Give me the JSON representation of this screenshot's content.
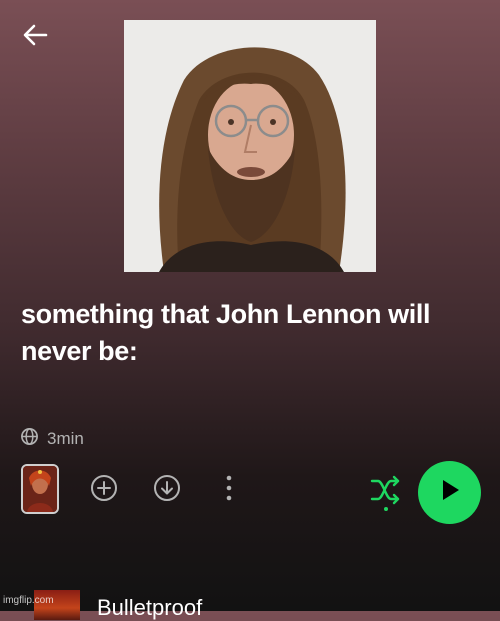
{
  "header": {
    "back_icon": "arrow-left-icon"
  },
  "playlist": {
    "title": "something that John Lennon will never be:",
    "duration": "3min",
    "globe_icon": "globe-icon"
  },
  "controls": {
    "add_icon": "plus-circle-icon",
    "download_icon": "download-circle-icon",
    "more_icon": "vertical-dots-icon",
    "shuffle_icon": "shuffle-icon",
    "play_icon": "play-icon"
  },
  "tracks": [
    {
      "title": "Bulletproof"
    }
  ],
  "colors": {
    "accent": "#1ed760",
    "muted_text": "#b3b3b3",
    "background_top": "#7a4f55",
    "background_bottom": "#121212"
  },
  "watermark": "imgflip.com"
}
